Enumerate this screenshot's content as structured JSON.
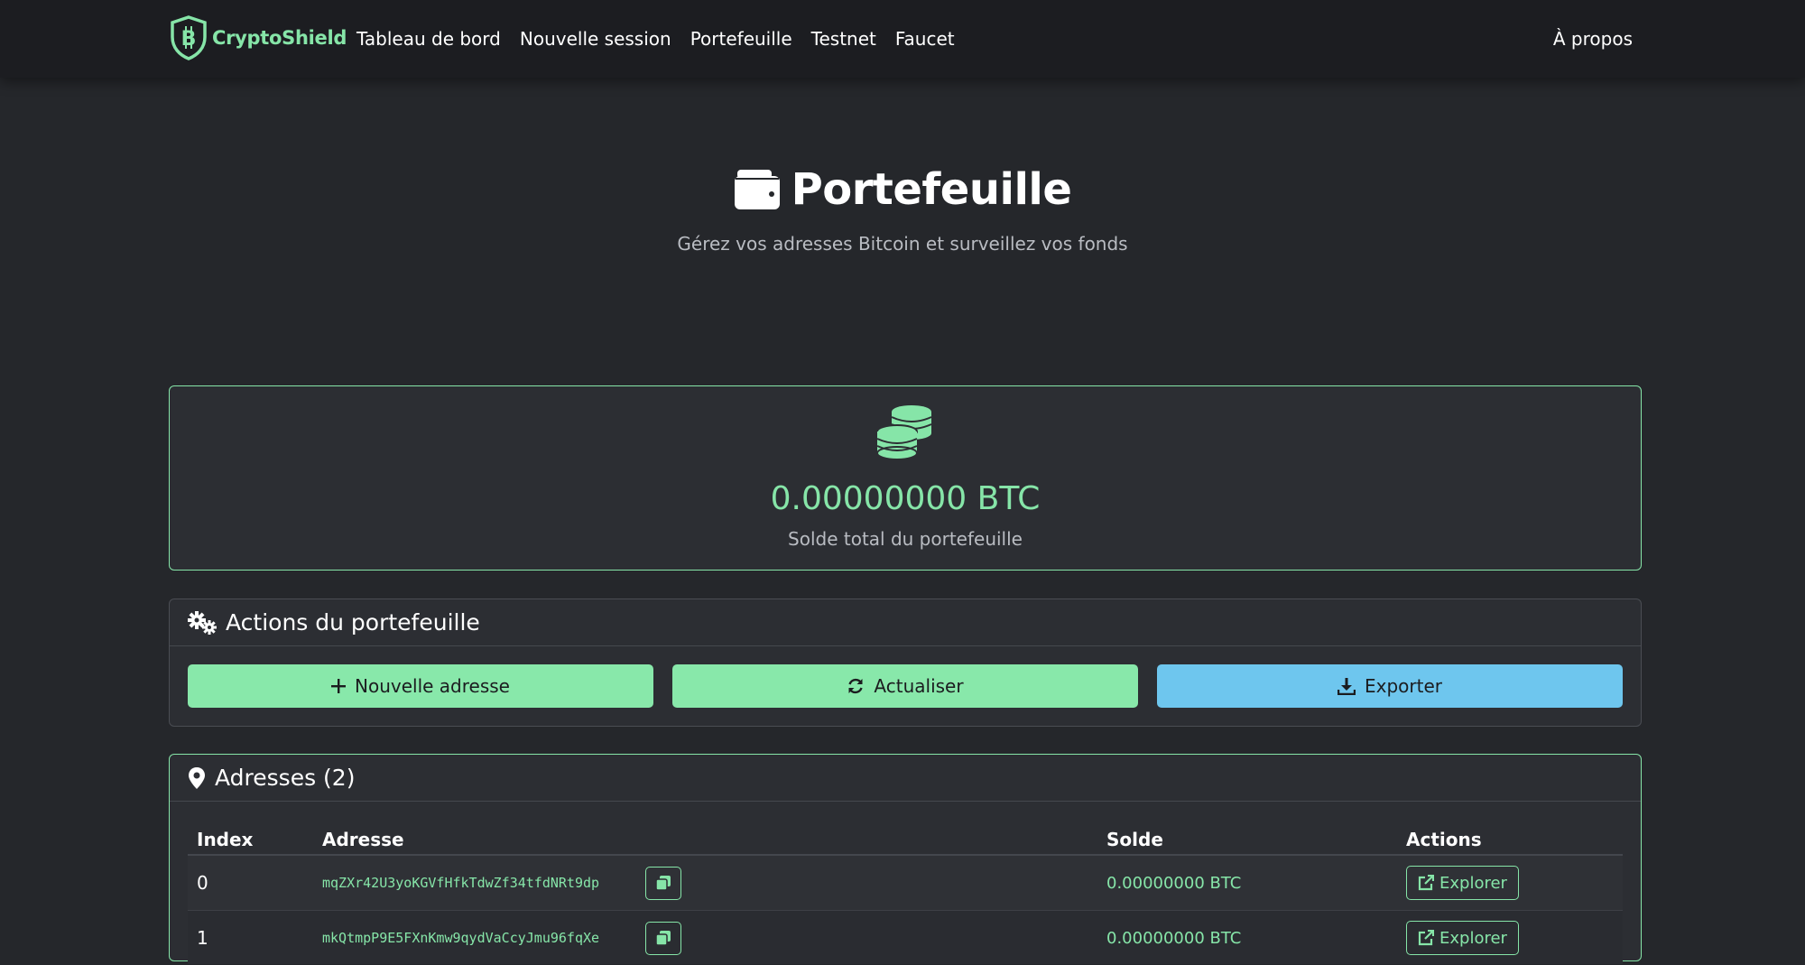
{
  "brand": {
    "name": "CryptoShield",
    "accent": "#86e5a8"
  },
  "nav": {
    "items": [
      {
        "label": "Tableau de bord"
      },
      {
        "label": "Nouvelle session"
      },
      {
        "label": "Portefeuille"
      },
      {
        "label": "Testnet"
      },
      {
        "label": "Faucet"
      }
    ],
    "right": "À propos"
  },
  "hero": {
    "icon": "wallet-icon",
    "title": "Portefeuille",
    "subtitle": "Gérez vos adresses Bitcoin et surveillez vos fonds"
  },
  "balance": {
    "icon": "coins-icon",
    "value": "0.00000000 BTC",
    "label": "Solde total du portefeuille"
  },
  "actions": {
    "icon": "gears-icon",
    "title": "Actions du portefeuille",
    "buttons": [
      {
        "label": "Nouvelle adresse",
        "icon": "plus-icon",
        "color": "#88e8aa"
      },
      {
        "label": "Actualiser",
        "icon": "refresh-icon",
        "color": "#88e8aa"
      },
      {
        "label": "Exporter",
        "icon": "download-icon",
        "color": "#6ec6ee"
      }
    ]
  },
  "addresses": {
    "icon": "map-pin-icon",
    "title": "Adresses (2)",
    "columns": [
      "Index",
      "Adresse",
      "Solde",
      "Actions"
    ],
    "rows": [
      {
        "index": "0",
        "address": "mqZXr42U3yoKGVfHfkTdwZf34tfdNRt9dp",
        "balance": "0.00000000 BTC",
        "action": "Explorer"
      },
      {
        "index": "1",
        "address": "mkQtmpP9E5FXnKmw9qydVaCcyJmu96fqXe",
        "balance": "0.00000000 BTC",
        "action": "Explorer"
      }
    ]
  }
}
